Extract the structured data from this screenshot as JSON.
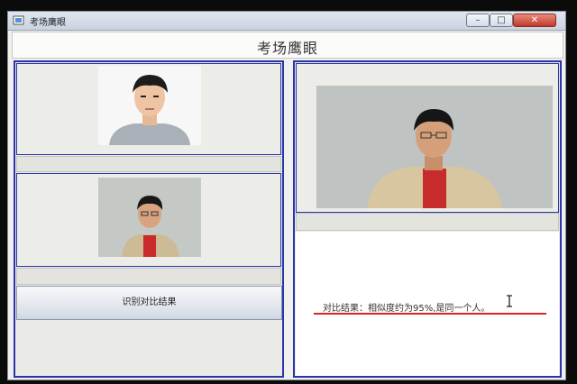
{
  "window": {
    "title": "考场鹰眼"
  },
  "controls": {
    "minimize": "–",
    "maximize": "□",
    "close": "✕"
  },
  "header": {
    "title": "考场鹰眼"
  },
  "left": {
    "registered_photo": {
      "icon": "person-id-photo"
    },
    "captured_photo": {
      "icon": "person-captured-photo"
    },
    "compare_button_label": "识别对比结果"
  },
  "right": {
    "live_video": {
      "icon": "person-live-camera"
    },
    "result_text": "对比结果：相似度约为95%,是同一个人。"
  },
  "colors": {
    "panel_border": "#2a35a8",
    "underline": "#dd2222",
    "close_button": "#c0392b"
  }
}
